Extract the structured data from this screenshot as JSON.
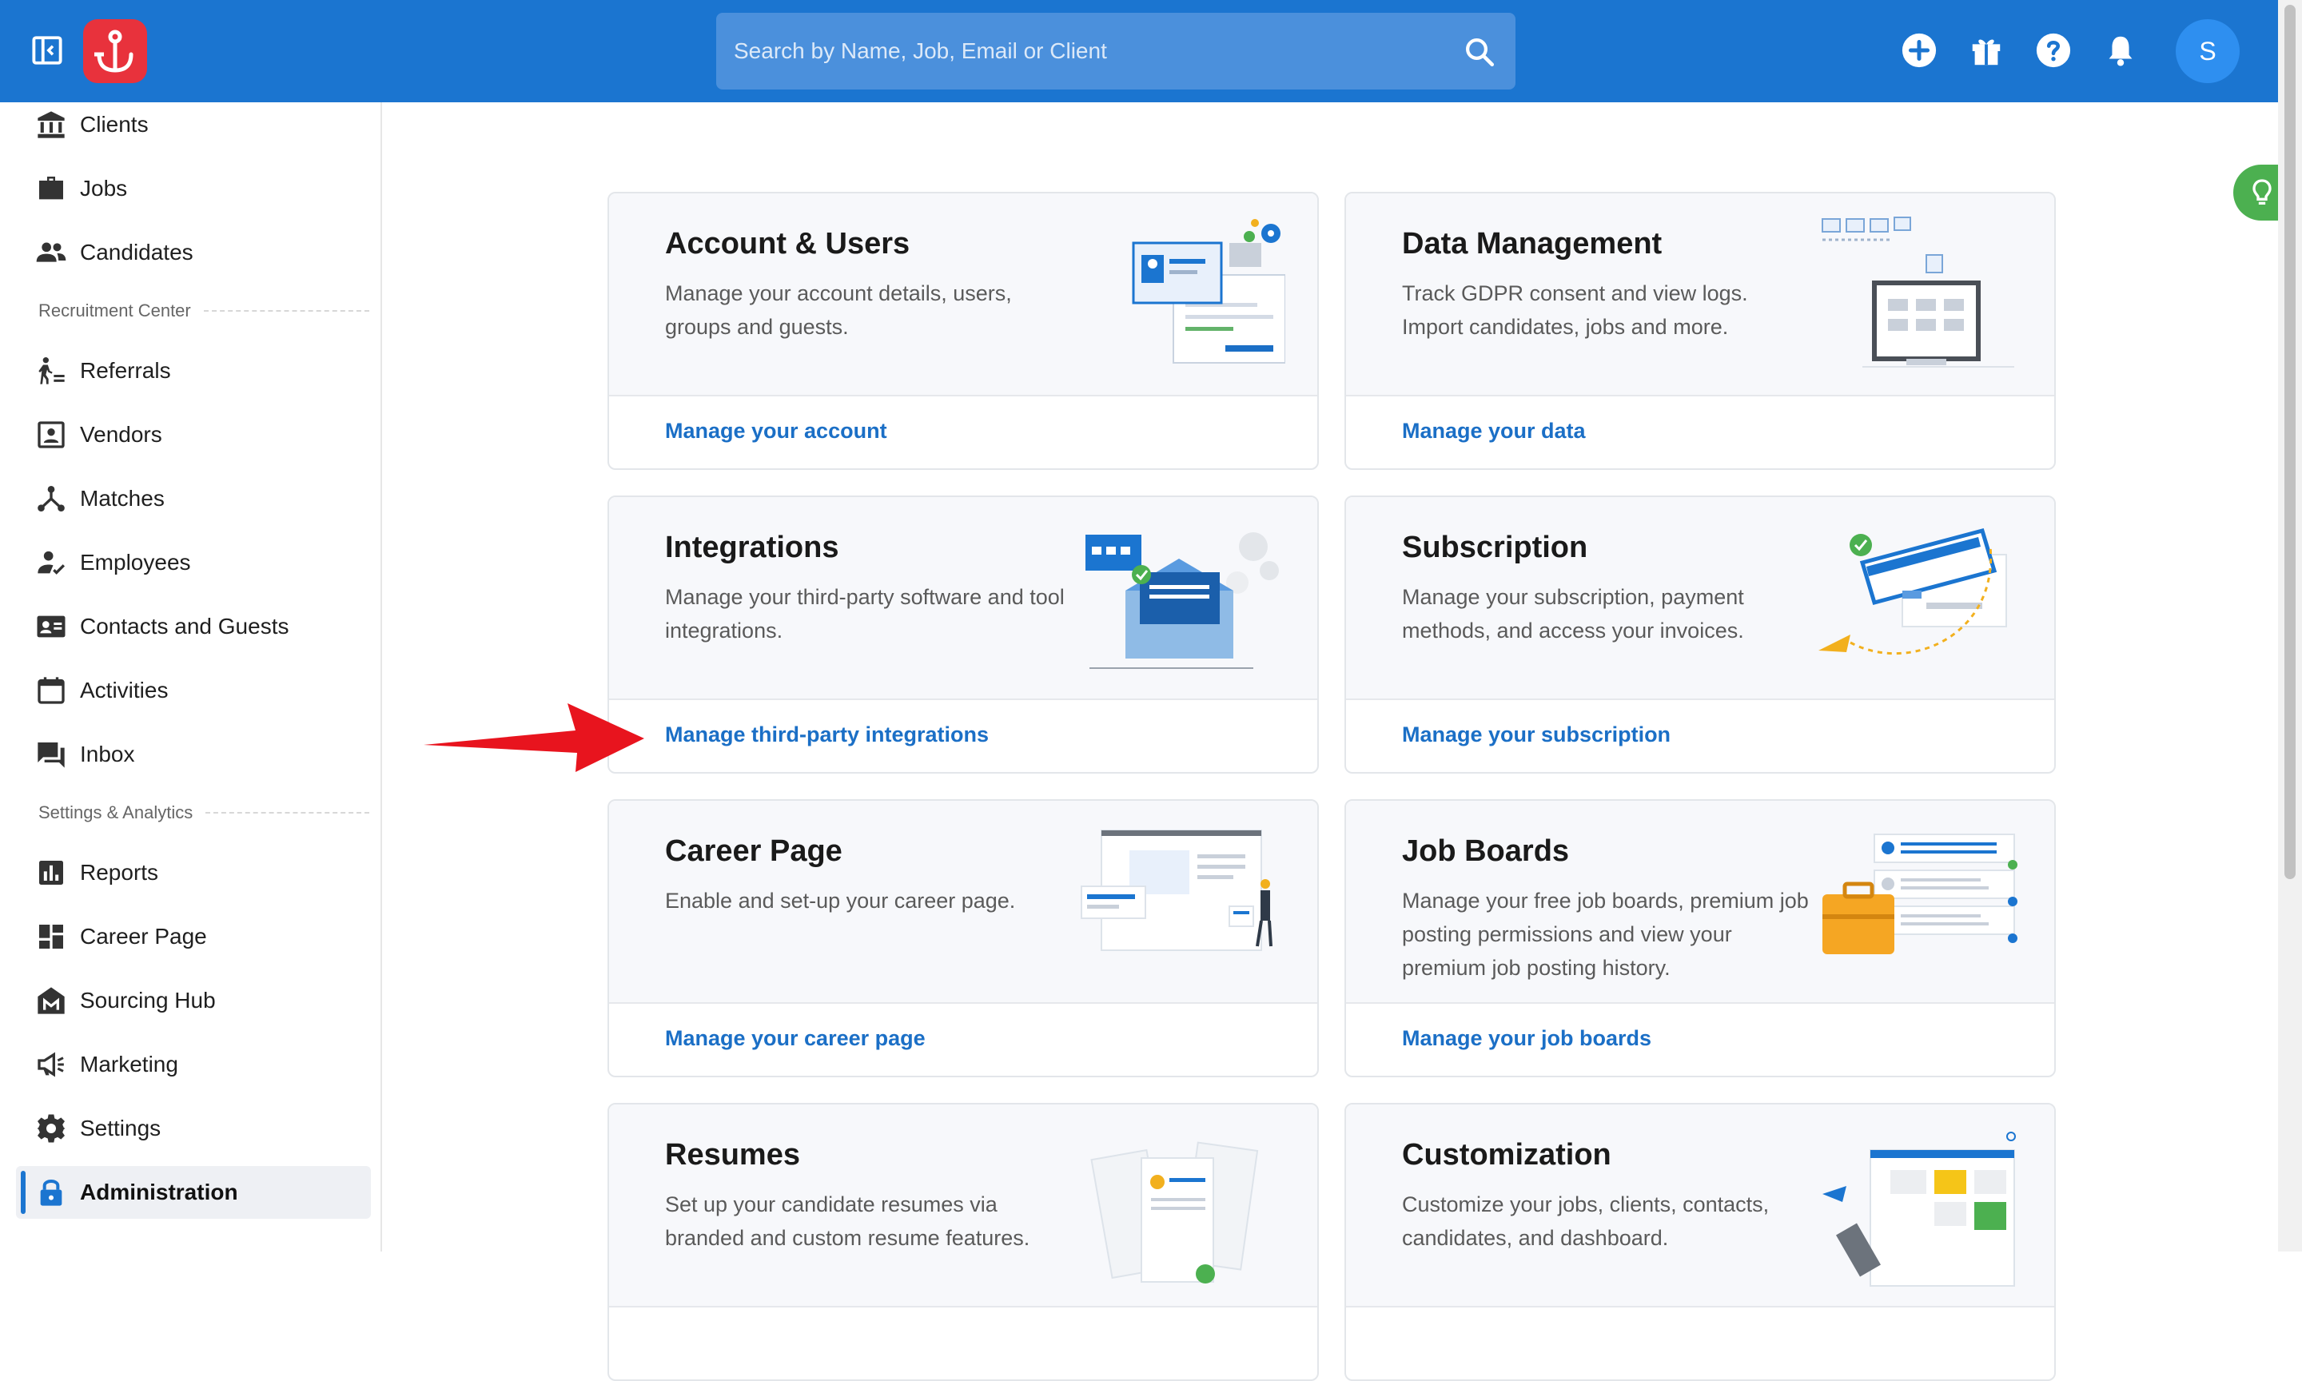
{
  "header": {
    "search_placeholder": "Search by Name, Job, Email or Client",
    "avatar_initial": "S",
    "brand_color": "#1b75d0",
    "logo_color": "#e8323c"
  },
  "sidebar": {
    "items": [
      {
        "label": "Clients",
        "icon": "bank-icon"
      },
      {
        "label": "Jobs",
        "icon": "briefcase-icon"
      },
      {
        "label": "Candidates",
        "icon": "people-icon"
      },
      {
        "label": "Referrals",
        "icon": "referral-icon"
      },
      {
        "label": "Vendors",
        "icon": "vendor-icon"
      },
      {
        "label": "Matches",
        "icon": "matches-icon"
      },
      {
        "label": "Employees",
        "icon": "employee-icon"
      },
      {
        "label": "Contacts and Guests",
        "icon": "contact-card-icon"
      },
      {
        "label": "Activities",
        "icon": "calendar-icon"
      },
      {
        "label": "Inbox",
        "icon": "chat-icon"
      },
      {
        "label": "Reports",
        "icon": "bar-chart-icon"
      },
      {
        "label": "Career Page",
        "icon": "dashboard-icon"
      },
      {
        "label": "Sourcing Hub",
        "icon": "sourcing-hub-icon"
      },
      {
        "label": "Marketing",
        "icon": "megaphone-icon"
      },
      {
        "label": "Settings",
        "icon": "gear-icon"
      },
      {
        "label": "Administration",
        "icon": "lock-icon",
        "active": true
      }
    ],
    "sections": {
      "recruitment": "Recruitment Center",
      "settings": "Settings & Analytics"
    }
  },
  "cards": [
    {
      "title": "Account & Users",
      "desc": "Manage your account details, users, groups and guests.",
      "link": "Manage your account"
    },
    {
      "title": "Data Management",
      "desc": "Track GDPR consent and view logs. Import candidates, jobs and more.",
      "link": "Manage your data"
    },
    {
      "title": "Integrations",
      "desc": "Manage your third-party software and tool integrations.",
      "link": "Manage third-party integrations"
    },
    {
      "title": "Subscription",
      "desc": "Manage your subscription, payment methods, and access your invoices.",
      "link": "Manage your subscription"
    },
    {
      "title": "Career Page",
      "desc": "Enable and set-up your career page.",
      "link": "Manage your career page"
    },
    {
      "title": "Job Boards",
      "desc": "Manage your free job boards, premium job posting permissions and view your premium job posting history.",
      "link": "Manage your job boards"
    },
    {
      "title": "Resumes",
      "desc": "Set up your candidate resumes via branded and custom resume features.",
      "link": ""
    },
    {
      "title": "Customization",
      "desc": "Customize your jobs, clients, contacts, candidates, and dashboard.",
      "link": ""
    }
  ]
}
